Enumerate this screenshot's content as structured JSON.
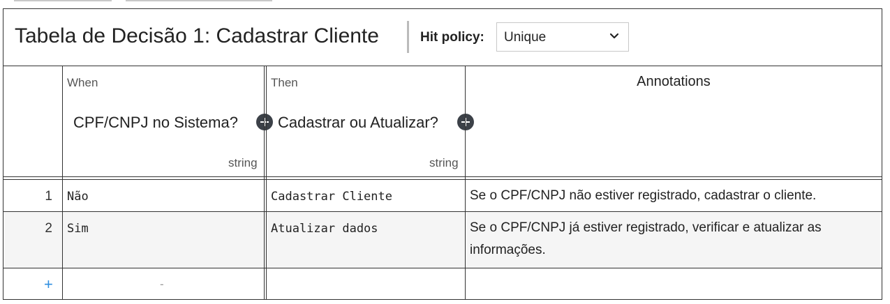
{
  "header": {
    "title": "Tabela de Decisão 1: Cadastrar Cliente",
    "hit_policy_label": "Hit policy:",
    "hit_policy_value": "Unique"
  },
  "columns": {
    "input": {
      "kind": "When",
      "name": "CPF/CNPJ no Sistema?",
      "type": "string"
    },
    "output": {
      "kind": "Then",
      "name": "Cadastrar ou Atualizar?",
      "type": "string"
    },
    "annotations": {
      "name": "Annotations"
    }
  },
  "rules": [
    {
      "number": "1",
      "input": "Não",
      "output": "Cadastrar Cliente",
      "annotation": "Se o CPF/CNPJ não estiver registrado, cadastrar o cliente."
    },
    {
      "number": "2",
      "input": "Sim",
      "output": "Atualizar dados",
      "annotation": "Se o CPF/CNPJ já estiver registrado, verificar e atualizar as informações."
    }
  ],
  "footer": {
    "add_rule": "+",
    "placeholder": "-"
  },
  "icons": {
    "add_column": "plus-circle-icon",
    "dropdown": "chevron-down-icon"
  },
  "colors": {
    "border": "#333333",
    "row_alt": "#f5f5f5",
    "add_accent": "#2f8fe0"
  }
}
